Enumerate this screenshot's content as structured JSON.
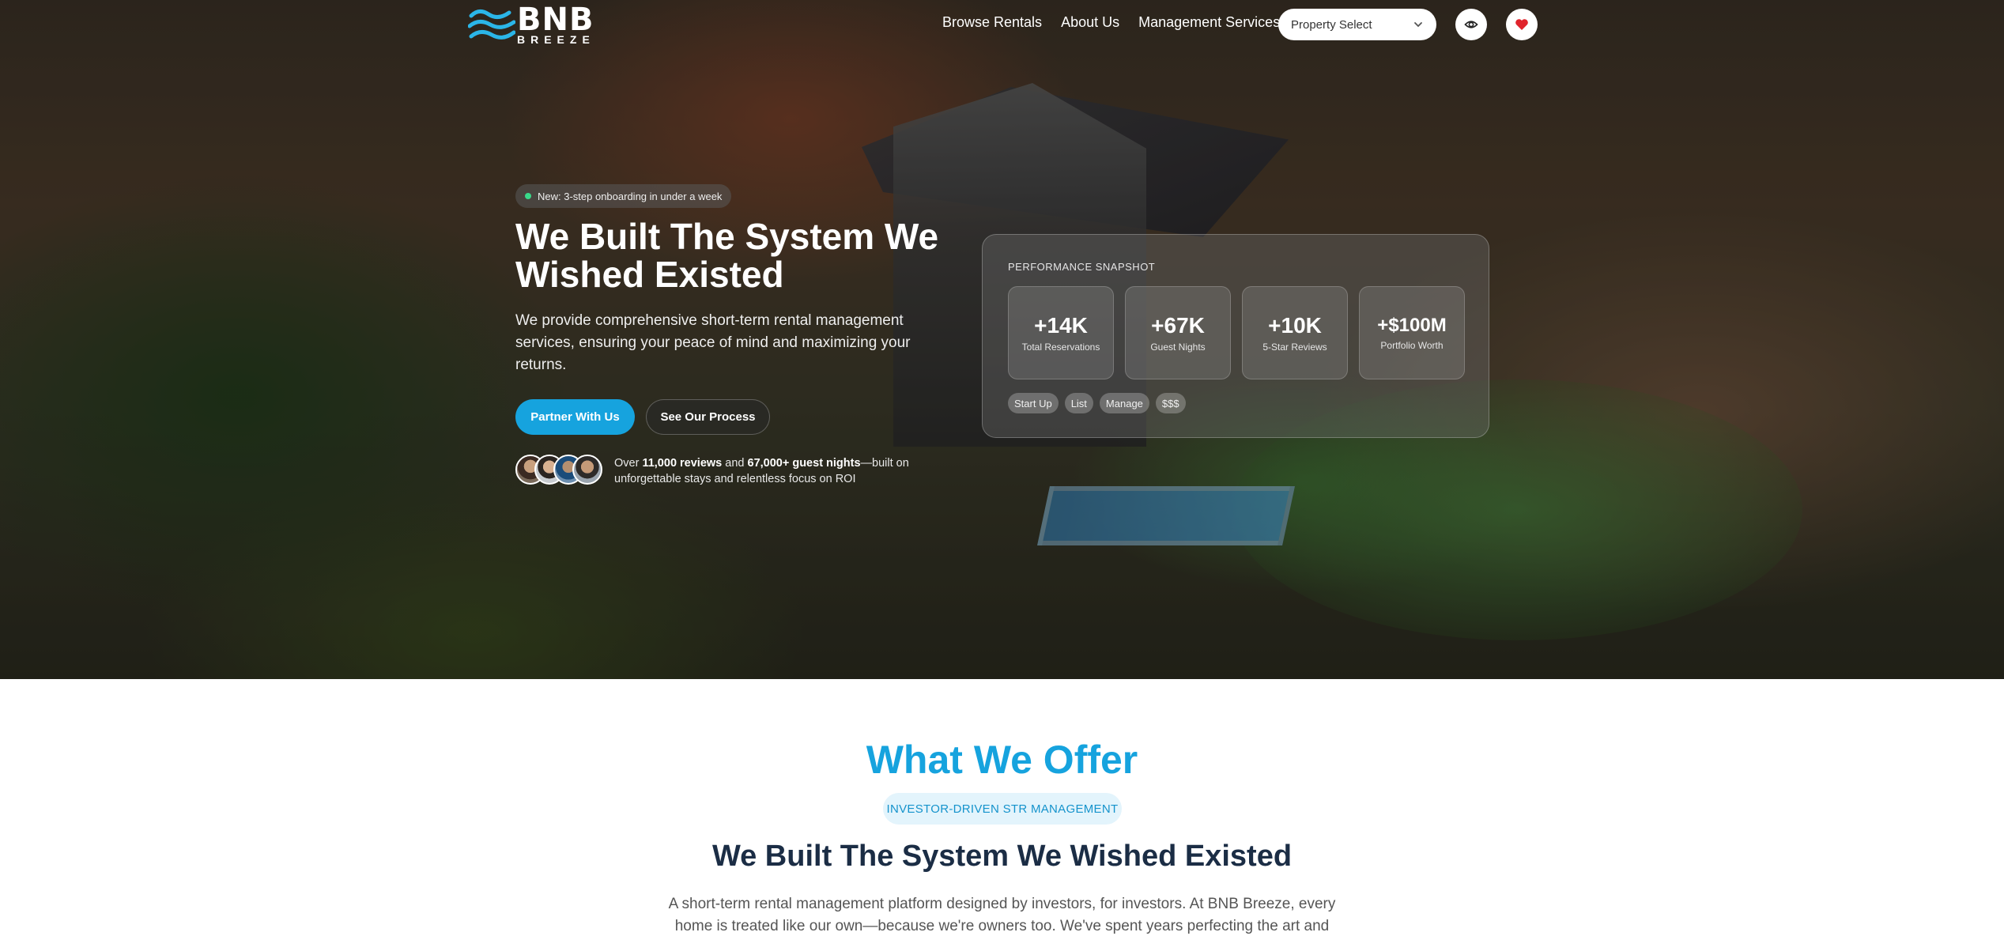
{
  "nav": {
    "logo_big": "BNB",
    "logo_small": "BREEZE",
    "links": [
      "Browse Rentals",
      "About Us",
      "Management Services"
    ],
    "property_select": "Property Select"
  },
  "hero": {
    "badge": "New: 3-step onboarding in under a week",
    "title": "We Built The System We Wished Existed",
    "subtitle": "We provide comprehensive short-term rental management services, ensuring your peace of mind and maximizing your returns.",
    "primary_button": "Partner With Us",
    "secondary_button": "See Our Process",
    "proof_prefix": "Over ",
    "proof_reviews": "11,000 reviews",
    "proof_mid": " and ",
    "proof_nights": "67,000+ guest nights",
    "proof_suffix": "—built on unforgettable stays and relentless focus on ROI"
  },
  "performance": {
    "title": "PERFORMANCE SNAPSHOT",
    "stats": [
      {
        "value": "+14K",
        "label": "Total Reservations"
      },
      {
        "value": "+67K",
        "label": "Guest Nights"
      },
      {
        "value": "+10K",
        "label": "5-Star Reviews"
      },
      {
        "value": "+$100M",
        "label": "Portfolio Worth"
      }
    ],
    "chips": [
      "Start Up",
      "List",
      "Manage",
      "$$$"
    ]
  },
  "offer": {
    "title": "What We Offer",
    "pill": "INVESTOR-DRIVEN STR MANAGEMENT",
    "heading": "We Built The System We Wished Existed",
    "body": "A short-term rental management platform designed by investors, for investors. At BNB Breeze, every home is treated like our own—because we're owners too. We've spent years perfecting the art and science of"
  },
  "colors": {
    "accent": "#16a3de",
    "heading_dark": "#1b2d45",
    "heart": "#e0242c",
    "status_dot": "#39d98a"
  },
  "icons": [
    "waves-logo-icon",
    "chevron-down-icon",
    "eye-icon",
    "heart-icon"
  ]
}
